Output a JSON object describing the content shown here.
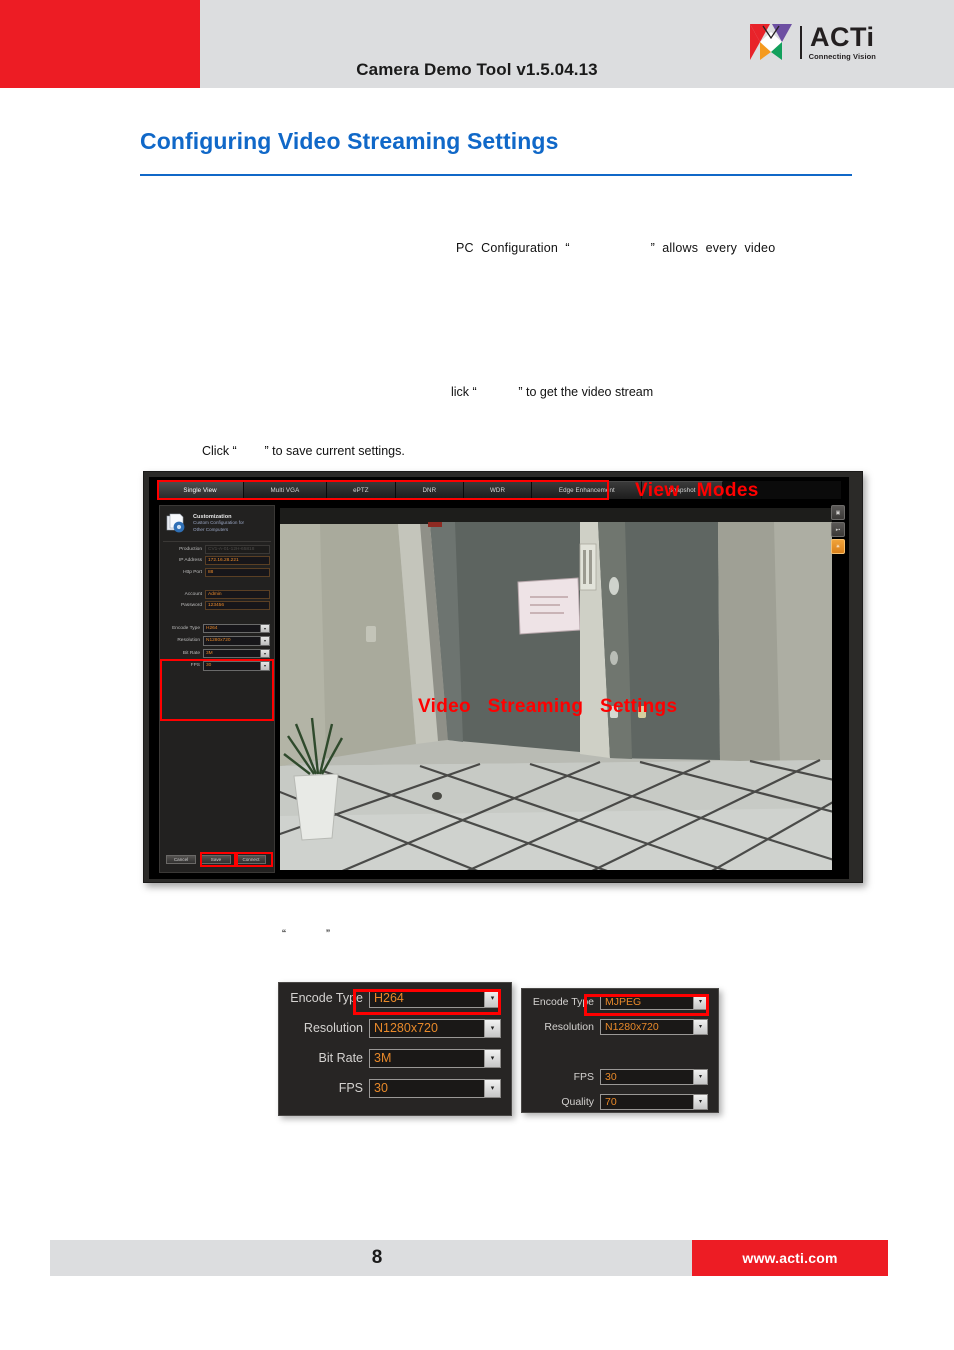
{
  "header": {
    "title": "Camera Demo Tool v1.5.04.13",
    "logo_name": "ACTi",
    "logo_tagline": "Connecting Vision",
    "accent_red": "#ed1c24",
    "band_grey": "#dcdddf"
  },
  "document": {
    "heading": "Configuring Video Streaming Settings",
    "heading_color": "#1068c8",
    "paragraphs": {
      "p1": "PC  Configuration  “                      ”  allows  every  video",
      "p2": "lick “            ” to get the video stream",
      "p3": "Click “        ” to save current settings.",
      "p4": "“            ”"
    }
  },
  "app": {
    "tabs": [
      {
        "label": "Single View",
        "active": true
      },
      {
        "label": "Multi VGA",
        "active": false
      },
      {
        "label": "ePTZ",
        "active": false
      },
      {
        "label": "DNR",
        "active": false
      },
      {
        "label": "WDR",
        "active": false
      },
      {
        "label": "Edge Enhancement",
        "active": false
      },
      {
        "label": "Snapshot",
        "active": false
      }
    ],
    "annotations": {
      "view_modes": "View   Modes",
      "video_streaming_settings": "Video   Streaming   Settings",
      "color": "#ff0000"
    },
    "panel": {
      "title": "Customization",
      "subtitle_line1": "Custom Configuration for",
      "subtitle_line2": "Other Computers",
      "icon": "documents-gear-icon",
      "fields": [
        {
          "label": "Production",
          "value": "CV1-A-01-12H-65818",
          "dim": true
        },
        {
          "label": "IP Address",
          "value": "172.16.28.221",
          "dim": false
        },
        {
          "label": "Http Port",
          "value": "88",
          "dim": false
        }
      ],
      "credentials": [
        {
          "label": "Account",
          "value": "Admin"
        },
        {
          "label": "Password",
          "value": "123456"
        }
      ],
      "stream_settings": [
        {
          "label": "Encode Type",
          "value": "H264"
        },
        {
          "label": "Resolution",
          "value": "N1280x720"
        },
        {
          "label": "Bit Rate",
          "value": "3M"
        },
        {
          "label": "FPS",
          "value": "30"
        }
      ],
      "buttons": [
        {
          "label": "Cancel",
          "highlighted": false
        },
        {
          "label": "Save",
          "highlighted": true
        },
        {
          "label": "Connect",
          "highlighted": true
        }
      ]
    },
    "side_tools": [
      {
        "icon": "camera-icon",
        "active": false
      },
      {
        "icon": "play-pause-icon",
        "active": false
      },
      {
        "icon": "settings-icon",
        "active": true
      }
    ]
  },
  "dialogs": {
    "h264": {
      "rows": [
        {
          "label": "Encode Type",
          "value": "H264",
          "highlighted": true
        },
        {
          "label": "Resolution",
          "value": "N1280x720",
          "highlighted": false
        },
        {
          "label": "Bit Rate",
          "value": "3M",
          "highlighted": false
        },
        {
          "label": "FPS",
          "value": "30",
          "highlighted": false
        }
      ]
    },
    "mjpeg": {
      "rows": [
        {
          "label": "Encode Type",
          "value": "MJPEG",
          "highlighted": true
        },
        {
          "label": "Resolution",
          "value": "N1280x720",
          "highlighted": false
        },
        {
          "label": "",
          "value": "",
          "spacer": true
        },
        {
          "label": "FPS",
          "value": "30",
          "highlighted": false
        },
        {
          "label": "Quality",
          "value": "70",
          "highlighted": false
        }
      ]
    }
  },
  "footer": {
    "page_number": "8",
    "url": "www.acti.com",
    "url_bg": "#ed1c24"
  }
}
